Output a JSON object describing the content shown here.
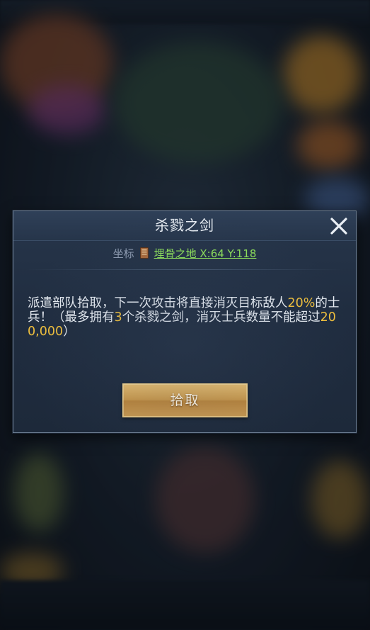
{
  "dialog": {
    "title": "杀戮之剑",
    "coord_label": "坐标",
    "coord_link": "埋骨之地 X:64  Y:118",
    "description_parts": {
      "p1": "派遣部队拾取，下一次攻击将直接消灭目标敌人",
      "h1": "20%",
      "p2": "的士兵！（最多拥有",
      "h2": "3",
      "p3": "个杀戮之剑，消灭士兵数量不能超过",
      "h3": "200,000",
      "p4": "）"
    },
    "pickup_button": "拾取"
  },
  "colors": {
    "highlight": "#f2c13c",
    "link_green": "#8ee05a",
    "button_gold": "#c8974a"
  },
  "icons": [
    "close-icon",
    "book-icon"
  ]
}
